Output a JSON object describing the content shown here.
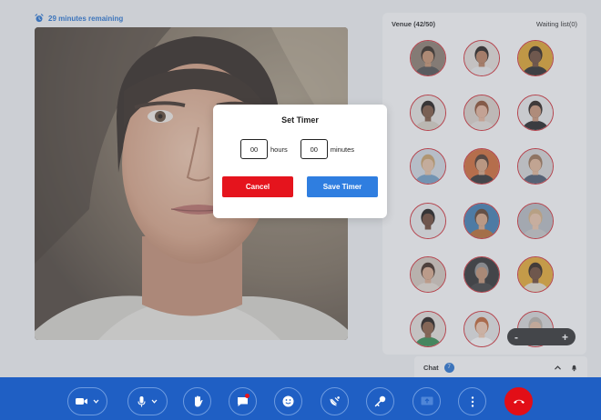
{
  "status": {
    "timer_text": "29 minutes remaining",
    "icon": "alarm-clock-icon",
    "color": "#1f6fd1"
  },
  "venue": {
    "title": "Venue (42/50)",
    "waiting": "Waiting list(0)",
    "participants": [
      {
        "bg": "#8a7a6a",
        "skin": "#c68f6a",
        "hair": "#2e2218",
        "shirt": "#4a4a4a"
      },
      {
        "bg": "#e8e1da",
        "skin": "#b87d5a",
        "hair": "#1e1712",
        "shirt": "#eeeeee"
      },
      {
        "bg": "#e1a325",
        "skin": "#6a4632",
        "hair": "#241812",
        "shirt": "#222222"
      },
      {
        "bg": "#e9e6e2",
        "skin": "#7a523a",
        "hair": "#1a1410",
        "shirt": "#d9d2c4"
      },
      {
        "bg": "#ddd3cb",
        "skin": "#e6b399",
        "hair": "#8a4a2a",
        "shirt": "#e8e2dc"
      },
      {
        "bg": "#ededed",
        "skin": "#c99274",
        "hair": "#241a14",
        "shirt": "#1c1c1c"
      },
      {
        "bg": "#d3dbe4",
        "skin": "#e8c2a4",
        "hair": "#c9a066",
        "shirt": "#6f9cc4"
      },
      {
        "bg": "#d2662e",
        "skin": "#d7a27e",
        "hair": "#4a3022",
        "shirt": "#2b2b2b"
      },
      {
        "bg": "#d8d8d8",
        "skin": "#e4b595",
        "hair": "#9a7050",
        "shirt": "#46556a"
      },
      {
        "bg": "#eeeeee",
        "skin": "#6b4330",
        "hair": "#161210",
        "shirt": "#ececec"
      },
      {
        "bg": "#3a7ab0",
        "skin": "#d8a584",
        "hair": "#5a3a26",
        "shirt": "#b9672a"
      },
      {
        "bg": "#b7bcc2",
        "skin": "#ecc4a8",
        "hair": "#d4b080",
        "shirt": "#c8c8c8"
      },
      {
        "bg": "#d6c9bd",
        "skin": "#dba98a",
        "hair": "#3a2418",
        "shirt": "#e6ddd3"
      },
      {
        "bg": "#2a2a2a",
        "skin": "#c08e6e",
        "hair": "#8e8e8e",
        "shirt": "#3a3a3a"
      },
      {
        "bg": "#e8a82a",
        "skin": "#6a4430",
        "hair": "#2a1c14",
        "shirt": "#e8e0d0"
      },
      {
        "bg": "#e8e2dc",
        "skin": "#8a5a3e",
        "hair": "#1c1410",
        "shirt": "#2e8a4a"
      },
      {
        "bg": "#e6e6e6",
        "skin": "#f0c9b0",
        "hair": "#c0602e",
        "shirt": "#ffffff"
      },
      {
        "bg": "#d9d9d9",
        "skin": "#e4bca0",
        "hair": "#b8b2a8",
        "shirt": "#cfcfcf"
      }
    ]
  },
  "zoom": {
    "minus": "-",
    "plus": "+"
  },
  "chat": {
    "label": "Chat",
    "count": "7"
  },
  "modal": {
    "title": "Set Timer",
    "hours_value": "00",
    "hours_label": "hours",
    "minutes_value": "00",
    "minutes_label": "minutes",
    "cancel_label": "Cancel",
    "save_label": "Save Timer"
  },
  "toolbar": {
    "buttons": [
      {
        "name": "video-camera-button",
        "icon": "video-camera-icon"
      },
      {
        "name": "microphone-button",
        "icon": "microphone-icon"
      },
      {
        "name": "raise-hand-button",
        "icon": "hand-icon"
      },
      {
        "name": "chat-toggle-button",
        "icon": "message-icon"
      },
      {
        "name": "emoji-button",
        "icon": "smiley-icon"
      },
      {
        "name": "broadcast-button",
        "icon": "satellite-dish-icon"
      },
      {
        "name": "key-button",
        "icon": "key-icon"
      },
      {
        "name": "share-screen-button",
        "icon": "share-screen-icon"
      },
      {
        "name": "more-options-button",
        "icon": "more-vertical-icon"
      },
      {
        "name": "end-call-button",
        "icon": "hang-up-icon"
      }
    ],
    "colors": {
      "bar": "#1f5fc4",
      "end_call": "#e20e17"
    }
  }
}
